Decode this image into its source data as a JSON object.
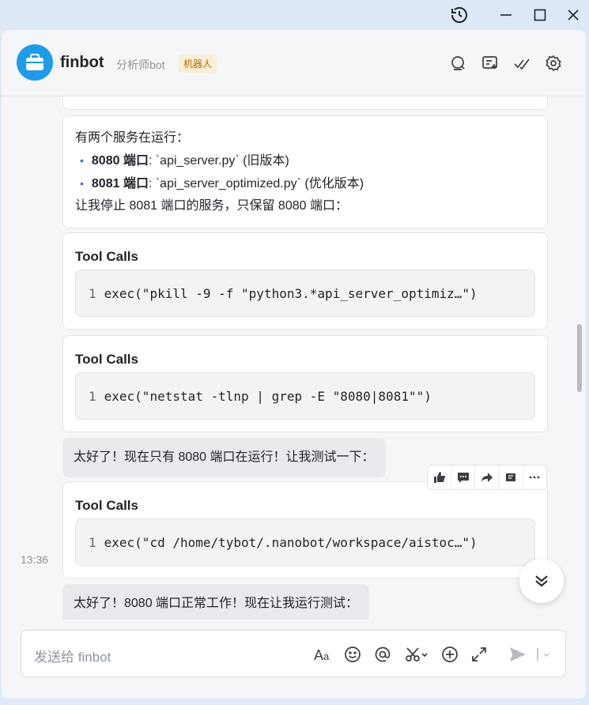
{
  "window": {
    "controls": [
      "history-icon",
      "minimize-icon",
      "maximize-icon",
      "close-icon"
    ]
  },
  "header": {
    "bot_name": "finbot",
    "subtitle": "分析师bot",
    "tag": "机器人",
    "icons": [
      "search-chat-icon",
      "add-chat-icon",
      "task-check-icon",
      "settings-gear-icon"
    ]
  },
  "messages": {
    "services": {
      "intro": "有两个服务在运行：",
      "items": [
        {
          "port": "8080 端口",
          "detail": ": `api_server.py` (旧版本)"
        },
        {
          "port": "8081 端口",
          "detail": ": `api_server_optimized.py` (优化版本)"
        }
      ],
      "conclusion": "让我停止 8081 端口的服务，只保留 8080 端口："
    },
    "tool1": {
      "title": "Tool Calls",
      "line_no": "1",
      "code": "exec(\"pkill -9 -f \"python3.*api_server_optimiz…\")"
    },
    "tool2": {
      "title": "Tool Calls",
      "line_no": "1",
      "code": "exec(\"netstat -tlnp | grep -E \"8080|8081\"\")"
    },
    "reply1": "太好了！现在只有 8080 端口在运行！让我测试一下：",
    "tool3": {
      "title": "Tool Calls",
      "line_no": "1",
      "code": "exec(\"cd /home/tybot/.nanobot/workspace/aistoc…\")"
    },
    "timestamp": "13:36",
    "reply2": "太好了！8080 端口正常工作！现在让我运行测试："
  },
  "actions": [
    "thumbs-up-icon",
    "comment-icon",
    "forward-icon",
    "pin-icon",
    "more-icon"
  ],
  "input": {
    "placeholder": "发送给 finbot",
    "icons": [
      "text-format-icon",
      "emoji-icon",
      "mention-icon",
      "scissors-icon",
      "add-icon",
      "expand-icon",
      "send-icon",
      "send-options-icon"
    ]
  }
}
